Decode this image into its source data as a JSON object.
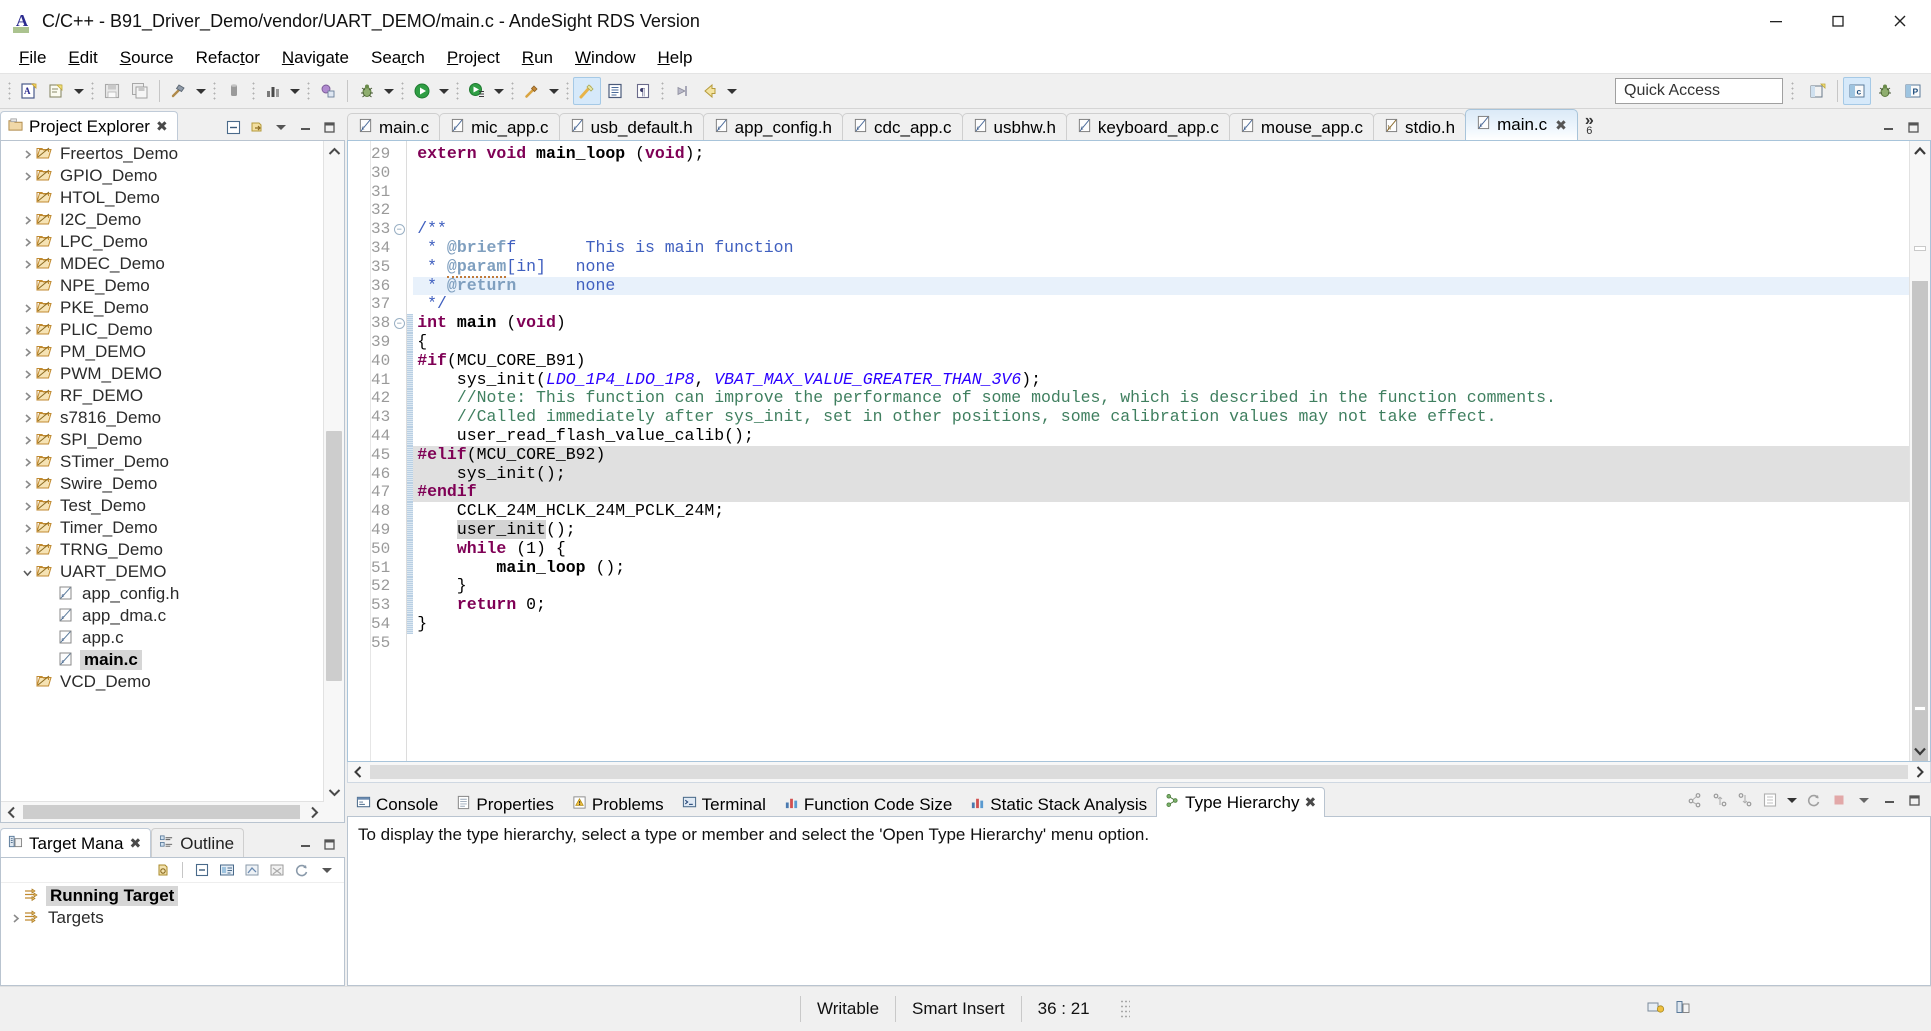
{
  "window": {
    "title": "C/C++ - B91_Driver_Demo/vendor/UART_DEMO/main.c - AndeSight RDS Version",
    "app_icon": "A",
    "minimize": "─",
    "maximize": "❐",
    "close": "✕"
  },
  "menubar": [
    {
      "label": "File",
      "mnemonic": "F"
    },
    {
      "label": "Edit",
      "mnemonic": "E"
    },
    {
      "label": "Source",
      "mnemonic": "S"
    },
    {
      "label": "Refactor",
      "mnemonic": "t"
    },
    {
      "label": "Navigate",
      "mnemonic": "N"
    },
    {
      "label": "Search",
      "mnemonic": "c"
    },
    {
      "label": "Project",
      "mnemonic": "P"
    },
    {
      "label": "Run",
      "mnemonic": "R"
    },
    {
      "label": "Window",
      "mnemonic": "W"
    },
    {
      "label": "Help",
      "mnemonic": "H"
    }
  ],
  "toolbar": {
    "quick_access_placeholder": "Quick Access",
    "buttons": [
      "new-c-cpp-project-icon",
      "new-wizard-icon",
      "new-dropdown-arrow",
      "save-icon",
      "save-all-icon",
      "build-hammer-icon",
      "build-dropdown-arrow",
      "binary-icon",
      "chart-icon",
      "chart-dropdown-arrow",
      "refactor-icon",
      "debug-bug-icon",
      "debug-dropdown-arrow",
      "run-icon",
      "run-dropdown-arrow",
      "profile-icon",
      "profile-dropdown-arrow",
      "external-tools-icon",
      "external-tools-dropdown-arrow",
      "toggle-mark-occurrences-icon",
      "show-whitespace-icon",
      "pilcrow-icon",
      "previous-annotation-icon",
      "back-arrow-icon",
      "back-dropdown-arrow"
    ],
    "perspective_buttons": [
      "open-perspective-icon",
      "cpp-perspective-icon",
      "debug-perspective-icon",
      "profiling-perspective-icon"
    ]
  },
  "project_explorer": {
    "tab_label": "Project Explorer",
    "tab_icon": "project-explorer-icon",
    "toolbar": [
      "collapse-all-icon",
      "link-with-editor-icon",
      "view-menu-icon",
      "minimize-icon",
      "maximize-icon"
    ],
    "tree": [
      {
        "label": "Freertos_Demo",
        "depth": 1,
        "kind": "project",
        "expandable": true,
        "expanded": false,
        "selected": false
      },
      {
        "label": "GPIO_Demo",
        "depth": 1,
        "kind": "project",
        "expandable": true,
        "expanded": false,
        "selected": false
      },
      {
        "label": "HTOL_Demo",
        "depth": 1,
        "kind": "project",
        "expandable": false,
        "expanded": false,
        "selected": false
      },
      {
        "label": "I2C_Demo",
        "depth": 1,
        "kind": "project",
        "expandable": true,
        "expanded": false,
        "selected": false
      },
      {
        "label": "LPC_Demo",
        "depth": 1,
        "kind": "project",
        "expandable": true,
        "expanded": false,
        "selected": false
      },
      {
        "label": "MDEC_Demo",
        "depth": 1,
        "kind": "project",
        "expandable": true,
        "expanded": false,
        "selected": false
      },
      {
        "label": "NPE_Demo",
        "depth": 1,
        "kind": "project",
        "expandable": false,
        "expanded": false,
        "selected": false
      },
      {
        "label": "PKE_Demo",
        "depth": 1,
        "kind": "project",
        "expandable": true,
        "expanded": false,
        "selected": false
      },
      {
        "label": "PLIC_Demo",
        "depth": 1,
        "kind": "project",
        "expandable": true,
        "expanded": false,
        "selected": false
      },
      {
        "label": "PM_DEMO",
        "depth": 1,
        "kind": "project",
        "expandable": true,
        "expanded": false,
        "selected": false
      },
      {
        "label": "PWM_DEMO",
        "depth": 1,
        "kind": "project",
        "expandable": true,
        "expanded": false,
        "selected": false
      },
      {
        "label": "RF_DEMO",
        "depth": 1,
        "kind": "project",
        "expandable": true,
        "expanded": false,
        "selected": false
      },
      {
        "label": "s7816_Demo",
        "depth": 1,
        "kind": "project",
        "expandable": true,
        "expanded": false,
        "selected": false
      },
      {
        "label": "SPI_Demo",
        "depth": 1,
        "kind": "project",
        "expandable": true,
        "expanded": false,
        "selected": false
      },
      {
        "label": "STimer_Demo",
        "depth": 1,
        "kind": "project",
        "expandable": true,
        "expanded": false,
        "selected": false
      },
      {
        "label": "Swire_Demo",
        "depth": 1,
        "kind": "project",
        "expandable": true,
        "expanded": false,
        "selected": false
      },
      {
        "label": "Test_Demo",
        "depth": 1,
        "kind": "project",
        "expandable": true,
        "expanded": false,
        "selected": false
      },
      {
        "label": "Timer_Demo",
        "depth": 1,
        "kind": "project",
        "expandable": true,
        "expanded": false,
        "selected": false
      },
      {
        "label": "TRNG_Demo",
        "depth": 1,
        "kind": "project",
        "expandable": true,
        "expanded": false,
        "selected": false
      },
      {
        "label": "UART_DEMO",
        "depth": 1,
        "kind": "project",
        "expandable": true,
        "expanded": true,
        "selected": false
      },
      {
        "label": "app_config.h",
        "depth": 2,
        "kind": "file",
        "expandable": false,
        "expanded": false,
        "selected": false
      },
      {
        "label": "app_dma.c",
        "depth": 2,
        "kind": "file",
        "expandable": false,
        "expanded": false,
        "selected": false
      },
      {
        "label": "app.c",
        "depth": 2,
        "kind": "file",
        "expandable": false,
        "expanded": false,
        "selected": false
      },
      {
        "label": "main.c",
        "depth": 2,
        "kind": "file",
        "expandable": false,
        "expanded": false,
        "selected": true
      },
      {
        "label": "VCD_Demo",
        "depth": 1,
        "kind": "project",
        "expandable": false,
        "expanded": false,
        "selected": false
      }
    ]
  },
  "target_manager": {
    "tabs": [
      {
        "label": "Target Mana",
        "icon": "target-manager-icon",
        "active": true,
        "closable": true
      },
      {
        "label": "Outline",
        "icon": "outline-icon",
        "active": false,
        "closable": false
      }
    ],
    "toolbar": [
      "refresh-target-icon",
      "collapse-all-icon",
      "new-target-icon",
      "connect-icon",
      "disconnect-icon",
      "reload-icon",
      "view-menu-icon"
    ],
    "window_buttons": [
      "minimize-icon",
      "maximize-icon"
    ],
    "items": [
      {
        "label": "Running Target",
        "expandable": false,
        "selected": true
      },
      {
        "label": "Targets",
        "expandable": true,
        "selected": false
      }
    ]
  },
  "editor": {
    "tabs": [
      {
        "label": "main.c",
        "icon": "c-file-icon",
        "active": false,
        "closable": false
      },
      {
        "label": "mic_app.c",
        "icon": "c-file-icon",
        "active": false,
        "closable": false
      },
      {
        "label": "usb_default.h",
        "icon": "c-file-icon",
        "active": false,
        "closable": false
      },
      {
        "label": "app_config.h",
        "icon": "c-file-icon",
        "active": false,
        "closable": false
      },
      {
        "label": "cdc_app.c",
        "icon": "c-file-icon",
        "active": false,
        "closable": false
      },
      {
        "label": "usbhw.h",
        "icon": "c-file-icon",
        "active": false,
        "closable": false
      },
      {
        "label": "keyboard_app.c",
        "icon": "c-file-icon",
        "active": false,
        "closable": false
      },
      {
        "label": "mouse_app.c",
        "icon": "c-file-icon",
        "active": false,
        "closable": false
      },
      {
        "label": "stdio.h",
        "icon": "h-file-icon",
        "active": false,
        "closable": false
      },
      {
        "label": "main.c",
        "icon": "c-file-icon",
        "active": true,
        "closable": true
      }
    ],
    "overflow_chevron": "»",
    "overflow_count": "6",
    "window_buttons": [
      "minimize-icon",
      "maximize-icon"
    ],
    "first_line_number": 29,
    "lines": [
      {
        "n": 29,
        "text": "extern void main_loop (void);"
      },
      {
        "n": 30,
        "text": ""
      },
      {
        "n": 31,
        "text": ""
      },
      {
        "n": 32,
        "text": ""
      },
      {
        "n": 33,
        "text": "/**"
      },
      {
        "n": 34,
        "text": " * @brief       This is main function"
      },
      {
        "n": 35,
        "text": " * @param[in]   none"
      },
      {
        "n": 36,
        "text": " * @return      none"
      },
      {
        "n": 37,
        "text": " */"
      },
      {
        "n": 38,
        "text": "int main (void)"
      },
      {
        "n": 39,
        "text": "{"
      },
      {
        "n": 40,
        "text": "#if(MCU_CORE_B91)"
      },
      {
        "n": 41,
        "text": "    sys_init(LDO_1P4_LDO_1P8, VBAT_MAX_VALUE_GREATER_THAN_3V6);"
      },
      {
        "n": 42,
        "text": "    //Note: This function can improve the performance of some modules, which is described in the function comments."
      },
      {
        "n": 43,
        "text": "    //Called immediately after sys_init, set in other positions, some calibration values may not take effect."
      },
      {
        "n": 44,
        "text": "    user_read_flash_value_calib();"
      },
      {
        "n": 45,
        "text": "#elif(MCU_CORE_B92)"
      },
      {
        "n": 46,
        "text": "    sys_init();"
      },
      {
        "n": 47,
        "text": "#endif"
      },
      {
        "n": 48,
        "text": "    CCLK_24M_HCLK_24M_PCLK_24M;"
      },
      {
        "n": 49,
        "text": "    user_init();"
      },
      {
        "n": 50,
        "text": "    while (1) {"
      },
      {
        "n": 51,
        "text": "        main_loop ();"
      },
      {
        "n": 52,
        "text": "    }"
      },
      {
        "n": 53,
        "text": "    return 0;"
      },
      {
        "n": 54,
        "text": "}"
      },
      {
        "n": 55,
        "text": ""
      }
    ],
    "highlighted_line": 36,
    "inactive_block_lines": [
      45,
      46,
      47
    ],
    "folding_lines": [
      33,
      38
    ]
  },
  "bottom_panel": {
    "tabs": [
      {
        "label": "Console",
        "icon": "console-icon",
        "active": false,
        "closable": false
      },
      {
        "label": "Properties",
        "icon": "properties-icon",
        "active": false,
        "closable": false
      },
      {
        "label": "Problems",
        "icon": "problems-icon",
        "active": false,
        "closable": false
      },
      {
        "label": "Terminal",
        "icon": "terminal-icon",
        "active": false,
        "closable": false
      },
      {
        "label": "Function Code Size",
        "icon": "bar-chart-icon",
        "active": false,
        "closable": false
      },
      {
        "label": "Static Stack Analysis",
        "icon": "bar-chart-icon",
        "active": false,
        "closable": false
      },
      {
        "label": "Type Hierarchy",
        "icon": "type-hierarchy-icon",
        "active": true,
        "closable": true
      }
    ],
    "toolbar": [
      "show-subtypes-icon",
      "show-supertypes-icon",
      "show-hierarchy-icon",
      "layout-icon",
      "layout-dropdown-arrow",
      "refresh-icon",
      "stop-icon",
      "view-menu-icon",
      "minimize-icon",
      "maximize-icon"
    ],
    "message": "To display the type hierarchy, select a type or member and select the 'Open Type Hierarchy' menu option."
  },
  "statusbar": {
    "writable": "Writable",
    "insert_mode": "Smart Insert",
    "cursor_position": "36 : 21",
    "icons": [
      "status-indicator-icon",
      "target-status-icon"
    ]
  },
  "colors": {
    "keyword": "#7f0055",
    "comment": "#3f7f5f",
    "macro": "#2a00ff",
    "line_number": "#9a9a9a",
    "highlight_line": "#e8f1fb",
    "inactive_block": "#e0e0e0",
    "selection": "#d6d6d6",
    "tab_active": "#dbeaf7"
  }
}
